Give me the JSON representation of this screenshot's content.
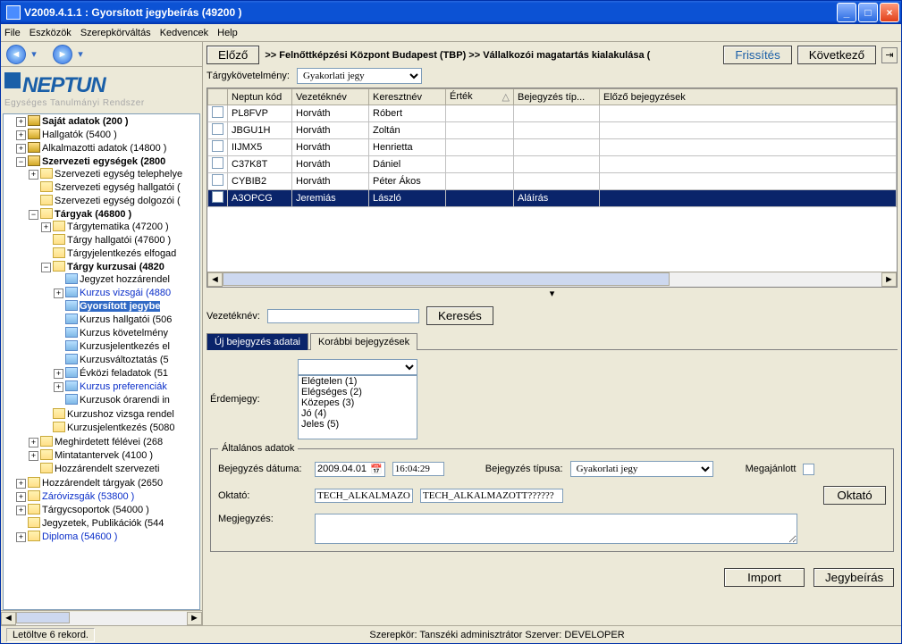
{
  "window_title": "V2009.4.1.1 : Gyorsított jegybeírás (49200   )",
  "menu": [
    "File",
    "Eszközök",
    "Szerepkörváltás",
    "Kedvencek",
    "Help"
  ],
  "logo_line2": "Egységes Tanulmányi Rendszer",
  "tree": {
    "n0": "Saját adatok (200   )",
    "n1": "Hallgatók (5400   )",
    "n2": "Alkalmazotti adatok (14800   )",
    "n3": "Szervezeti egységek (2800",
    "n3_0": "Szervezeti egység telephelye",
    "n3_1": "Szervezeti egység hallgatói (",
    "n3_2": "Szervezeti egység dolgozói (",
    "n3_3": "Tárgyak (46800   )",
    "n3_3_0": "Tárgytematika (47200   )",
    "n3_3_1": "Tárgy hallgatói (47600   )",
    "n3_3_2": "Tárgyjelentkezés elfogad",
    "n3_3_3": "Tárgy kurzusai (4820",
    "n3_3_3_0": "Jegyzet hozzárendel",
    "n3_3_3_1": "Kurzus vizsgái (4880",
    "n3_3_3_2": "Gyorsított jegybe",
    "n3_3_3_3": "Kurzus hallgatói (506",
    "n3_3_3_4": "Kurzus követelmény",
    "n3_3_3_5": "Kurzusjelentkezés el",
    "n3_3_3_6": "Kurzusváltoztatás (5",
    "n3_3_3_7": "Évközi feladatok (51",
    "n3_3_3_8": "Kurzus preferenciák",
    "n3_3_3_9": "Kurzusok órarendi in",
    "n3_3_4": "Kurzushoz vizsga rendel",
    "n3_3_5": "Kurzusjelentkezés (5080",
    "n3_4": "Meghirdetett félévei (268",
    "n3_5": "Mintatantervek (4100   )",
    "n3_6": "Hozzárendelt szervezeti",
    "n4": "Hozzárendelt tárgyak (2650",
    "n5": "Záróvizsgák (53800   )",
    "n6": "Tárgycsoportok (54000   )",
    "n7": "Jegyzetek, Publikációk (544",
    "n8": "Diploma (54600   )"
  },
  "top": {
    "prev": "Előző",
    "breadcrumb": ">>  Felnőttképzési Központ Budapest (TBP) >> Vállalkozói magatartás kialakulása (",
    "refresh": "Frissítés",
    "next": "Következő"
  },
  "req_label": "Tárgykövetelmény:",
  "req_value": "Gyakorlati jegy",
  "grid_headers": [
    "",
    "Neptun kód",
    "Vezetéknév",
    "Keresztnév",
    "Érték",
    "Bejegyzés típ...",
    "Előző bejegyzések"
  ],
  "grid_rows": [
    {
      "code": "PL8FVP",
      "last": "Horváth",
      "first": "Róbert",
      "val": "",
      "typ": "",
      "prev": ""
    },
    {
      "code": "JBGU1H",
      "last": "Horváth",
      "first": "Zoltán",
      "val": "",
      "typ": "",
      "prev": ""
    },
    {
      "code": "IIJMX5",
      "last": "Horváth",
      "first": "Henrietta",
      "val": "",
      "typ": "",
      "prev": ""
    },
    {
      "code": "C37K8T",
      "last": "Horváth",
      "first": "Dániel",
      "val": "",
      "typ": "",
      "prev": ""
    },
    {
      "code": "CYBIB2",
      "last": "Horváth",
      "first": "Péter Ákos",
      "val": "",
      "typ": "",
      "prev": ""
    },
    {
      "code": "A3OPCG",
      "last": "Jeremiás",
      "first": "László",
      "val": "",
      "typ": "Aláírás",
      "prev": ""
    }
  ],
  "search_label": "Vezetéknév:",
  "search_btn": "Keresés",
  "tab1": "Új bejegyzés adatai",
  "tab2": "Korábbi bejegyzések",
  "grade_label": "Érdemjegy:",
  "grades": [
    "Elégtelen (1)",
    "Elégséges (2)",
    "Közepes (3)",
    "Jó (4)",
    "Jeles (5)"
  ],
  "fieldset_legend": "Általános adatok",
  "date_label": "Bejegyzés dátuma:",
  "date_val": "2009.04.01",
  "time_val": "16:04:29",
  "type_label": "Bejegyzés típusa:",
  "type_val": "Gyakorlati jegy",
  "offered_label": "Megajánlott",
  "teacher_label": "Oktató:",
  "teacher_val1": "TECH_ALKALMAZOT",
  "teacher_val2": "TECH_ALKALMAZOTT??????",
  "teacher_btn": "Oktató",
  "note_label": "Megjegyzés:",
  "btn_import": "Import",
  "btn_write": "Jegybeírás",
  "status_left": "Letöltve 6 rekord.",
  "status_role": "Szerepkör: Tanszéki adminisztrátor   Szerver: DEVELOPER"
}
